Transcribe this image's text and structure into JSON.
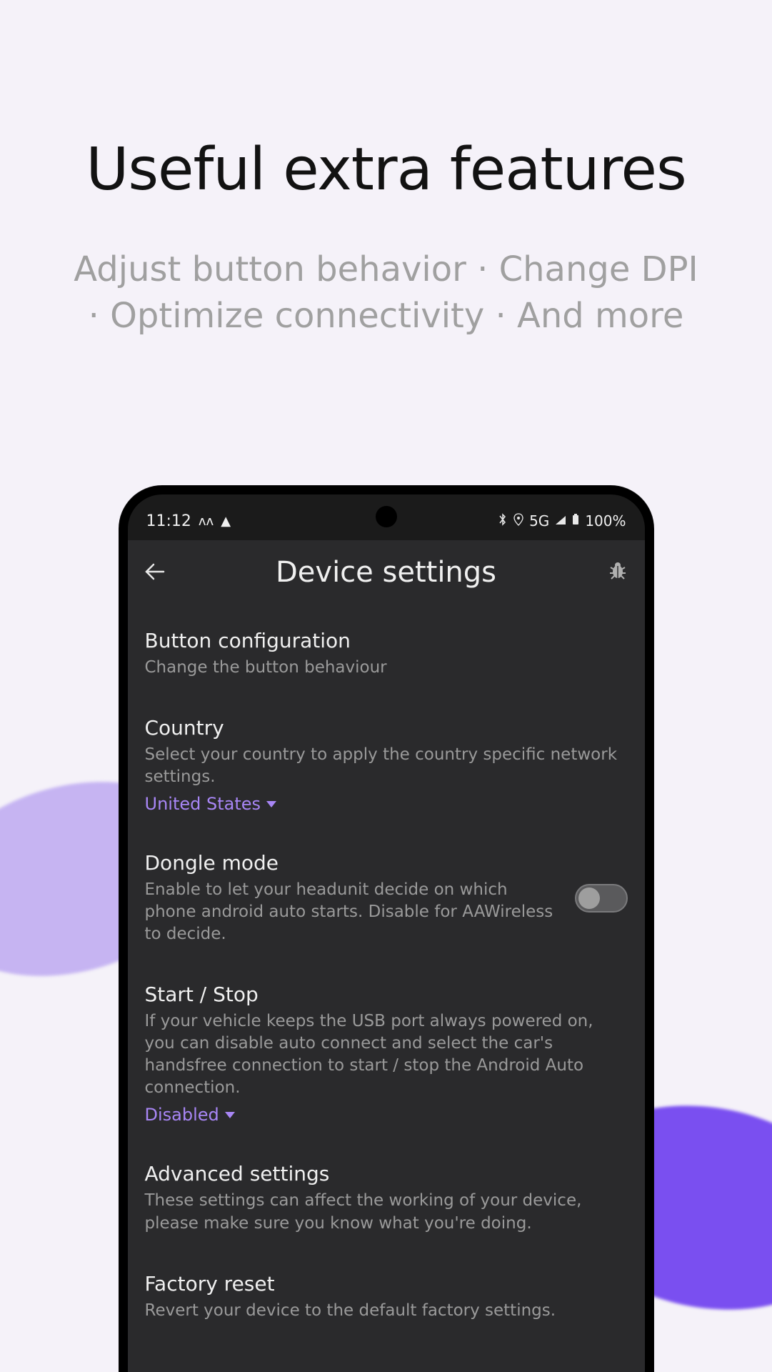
{
  "promo": {
    "title": "Useful extra features",
    "subtitle_line1": "Adjust button behavior · Change DPI",
    "subtitle_line2": "· Optimize connectivity · And more"
  },
  "status": {
    "time": "11:12",
    "network": "5G",
    "battery": "100%"
  },
  "header": {
    "title": "Device settings"
  },
  "settings": {
    "button_config": {
      "title": "Button configuration",
      "desc": "Change the button behaviour"
    },
    "country": {
      "title": "Country",
      "desc": "Select your country to apply the country specific network settings.",
      "value": "United States"
    },
    "dongle": {
      "title": "Dongle mode",
      "desc": "Enable to let your headunit decide on which phone android auto starts. Disable for AAWireless to decide.",
      "enabled": false
    },
    "startstop": {
      "title": "Start / Stop",
      "desc": "If your vehicle keeps the USB port always powered on, you can disable auto connect and select the car's handsfree connection to start / stop the Android Auto connection.",
      "value": "Disabled"
    },
    "advanced": {
      "title": "Advanced settings",
      "desc": "These settings can affect the working of your device, please make sure you know what you're doing."
    },
    "factory": {
      "title": "Factory reset",
      "desc": "Revert your device to the default factory settings."
    }
  }
}
